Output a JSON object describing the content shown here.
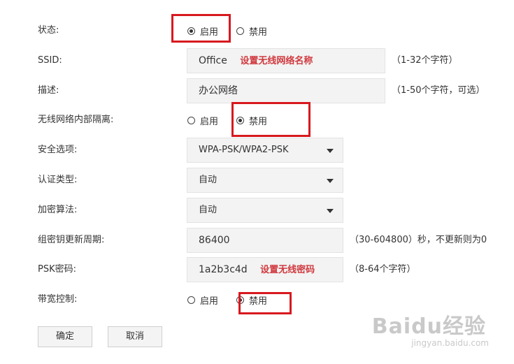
{
  "status": {
    "label": "状态:",
    "options": [
      "启用",
      "禁用"
    ],
    "selected": "启用"
  },
  "ssid": {
    "label": "SSID:",
    "value": "Office",
    "note": "设置无线网络名称",
    "hint": "（1-32个字符）"
  },
  "desc": {
    "label": "描述:",
    "value": "办公网络",
    "hint": "（1-50个字符，可选）"
  },
  "isolation": {
    "label": "无线网络内部隔离:",
    "options": [
      "启用",
      "禁用"
    ],
    "selected": "禁用"
  },
  "security": {
    "label": "安全选项:",
    "value": "WPA-PSK/WPA2-PSK"
  },
  "auth": {
    "label": "认证类型:",
    "value": "自动"
  },
  "encryption": {
    "label": "加密算法:",
    "value": "自动"
  },
  "group_key": {
    "label": "组密钥更新周期:",
    "value": "86400",
    "hint": "（30-604800）秒，不更新则为0"
  },
  "psk": {
    "label": "PSK密码:",
    "value": "1a2b3c4d",
    "note": "设置无线密码",
    "hint": "（8-64个字符）"
  },
  "bandwidth": {
    "label": "带宽控制:",
    "options": [
      "启用",
      "禁用"
    ],
    "selected": "禁用"
  },
  "buttons": {
    "ok": "确定",
    "cancel": "取消"
  },
  "watermark": {
    "main": "Baidu经验",
    "sub": "jingyan.baidu.com"
  },
  "colors": {
    "highlight": "#d7191f",
    "note": "#d0393e",
    "field_bg": "#f3f3f3"
  }
}
